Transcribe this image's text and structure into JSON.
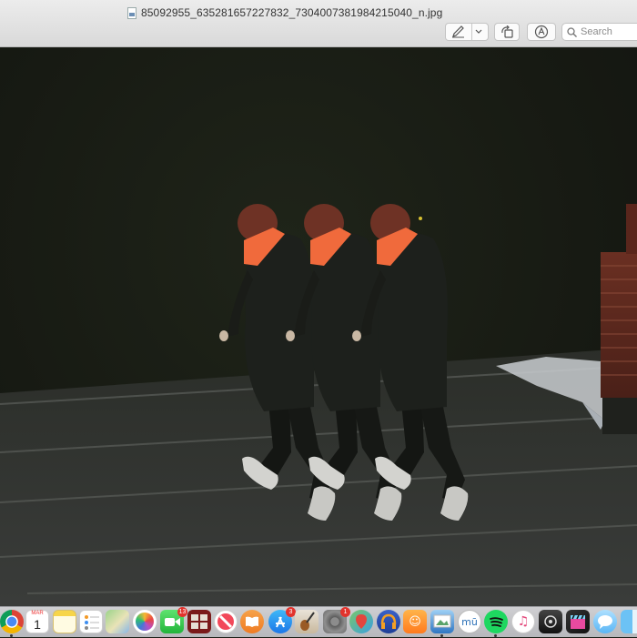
{
  "window": {
    "filename": "85092955_635281657227832_7304007381984215040_n.jpg"
  },
  "toolbar": {
    "markup_icon": "pen-markup-icon",
    "dropdown_icon": "chevron-down-icon",
    "rotate_icon": "rotate-icon",
    "annotate_icon": "annotate-circle-icon",
    "search_placeholder": "Search"
  },
  "dock": {
    "calendar_month": "MAR",
    "calendar_day": "1",
    "facetime_badge": "13",
    "appstore_badge": "3",
    "sysprefs_badge": "1",
    "apps": [
      {
        "name": "chrome-icon"
      },
      {
        "name": "calendar-icon"
      },
      {
        "name": "notes-icon"
      },
      {
        "name": "reminders-icon"
      },
      {
        "name": "maps-icon"
      },
      {
        "name": "photos-icon"
      },
      {
        "name": "facetime-icon"
      },
      {
        "name": "photo-booth-icon"
      },
      {
        "name": "news-icon"
      },
      {
        "name": "books-icon"
      },
      {
        "name": "app-store-icon"
      },
      {
        "name": "garageband-icon"
      },
      {
        "name": "system-preferences-icon"
      },
      {
        "name": "maps-pin-icon"
      },
      {
        "name": "audacity-icon"
      },
      {
        "name": "contacts-icon"
      },
      {
        "name": "preview-icon"
      },
      {
        "name": "musescore-icon"
      },
      {
        "name": "spotify-icon"
      },
      {
        "name": "itunes-icon"
      },
      {
        "name": "script-editor-icon"
      },
      {
        "name": "final-cut-icon"
      },
      {
        "name": "messages-icon"
      },
      {
        "name": "finder-icon"
      }
    ]
  }
}
